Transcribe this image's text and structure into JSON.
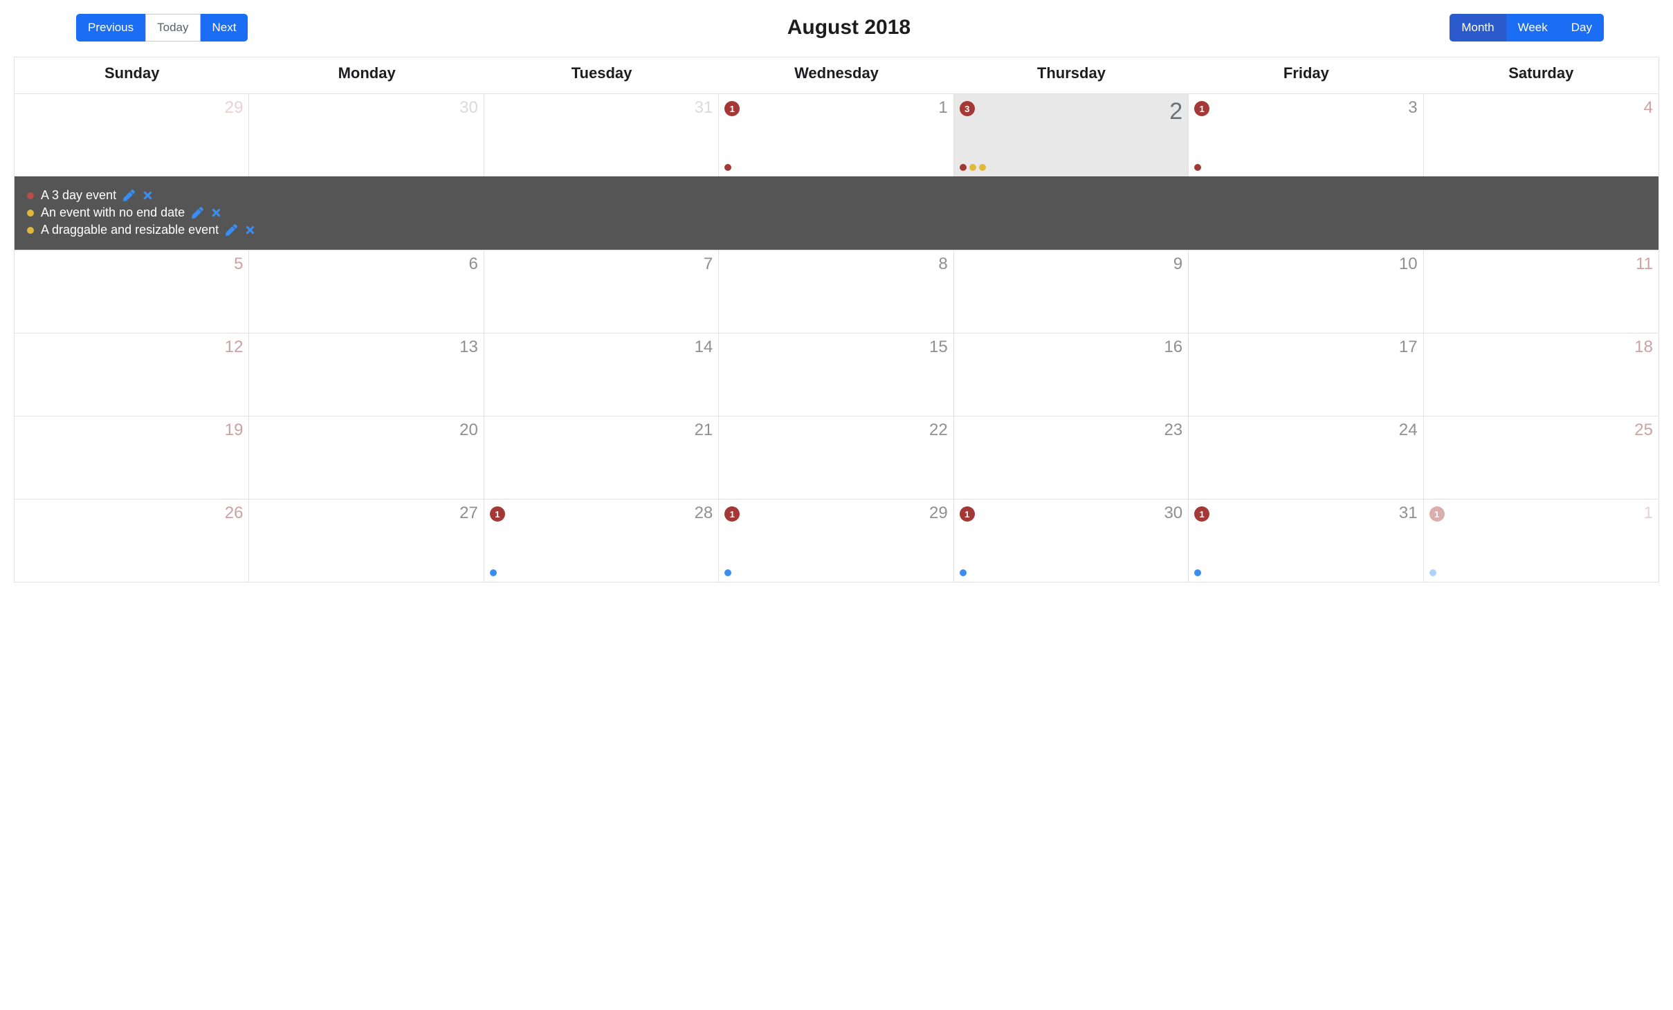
{
  "toolbar": {
    "previous_label": "Previous",
    "today_label": "Today",
    "next_label": "Next",
    "month_label": "Month",
    "week_label": "Week",
    "day_label": "Day"
  },
  "title": "August 2018",
  "weekdays": [
    "Sunday",
    "Monday",
    "Tuesday",
    "Wednesday",
    "Thursday",
    "Friday",
    "Saturday"
  ],
  "colors": {
    "primary": "#1b6ef3",
    "primary_active": "#2a5acb",
    "badge": "#a43836",
    "panel_bg": "#555555",
    "dot_red": "#a43836",
    "dot_yellow": "#e0b93a",
    "dot_blue": "#3a8df3"
  },
  "selected_day": 2,
  "events_panel": [
    {
      "label": "A 3 day event",
      "color": "red"
    },
    {
      "label": "An event with no end date",
      "color": "yellow"
    },
    {
      "label": "A draggable and resizable event",
      "color": "yellow"
    }
  ],
  "weeks": [
    {
      "has_panel_after": true,
      "days": [
        {
          "num": "29",
          "weekend": true,
          "other_month": true
        },
        {
          "num": "30",
          "other_month": true
        },
        {
          "num": "31",
          "other_month": true
        },
        {
          "num": "1",
          "badge": "1",
          "dots": [
            "red"
          ]
        },
        {
          "num": "2",
          "badge": "3",
          "dots": [
            "red",
            "yellow",
            "yellow"
          ],
          "highlight": true,
          "selected": true
        },
        {
          "num": "3",
          "badge": "1",
          "dots": [
            "red"
          ]
        },
        {
          "num": "4",
          "weekend": true
        }
      ]
    },
    {
      "days": [
        {
          "num": "5",
          "weekend": true
        },
        {
          "num": "6"
        },
        {
          "num": "7"
        },
        {
          "num": "8"
        },
        {
          "num": "9"
        },
        {
          "num": "10"
        },
        {
          "num": "11",
          "weekend": true
        }
      ]
    },
    {
      "days": [
        {
          "num": "12",
          "weekend": true
        },
        {
          "num": "13"
        },
        {
          "num": "14"
        },
        {
          "num": "15"
        },
        {
          "num": "16"
        },
        {
          "num": "17"
        },
        {
          "num": "18",
          "weekend": true
        }
      ]
    },
    {
      "days": [
        {
          "num": "19",
          "weekend": true
        },
        {
          "num": "20"
        },
        {
          "num": "21"
        },
        {
          "num": "22"
        },
        {
          "num": "23"
        },
        {
          "num": "24"
        },
        {
          "num": "25",
          "weekend": true
        }
      ]
    },
    {
      "days": [
        {
          "num": "26",
          "weekend": true
        },
        {
          "num": "27"
        },
        {
          "num": "28",
          "badge": "1",
          "dots": [
            "blue"
          ]
        },
        {
          "num": "29",
          "badge": "1",
          "dots": [
            "blue"
          ]
        },
        {
          "num": "30",
          "badge": "1",
          "dots": [
            "blue"
          ]
        },
        {
          "num": "31",
          "badge": "1",
          "dots": [
            "blue"
          ]
        },
        {
          "num": "1",
          "weekend": true,
          "other_month": true,
          "badge": "1",
          "badge_faded": true,
          "dots": [
            "blue"
          ],
          "dots_faded": true
        }
      ]
    }
  ]
}
